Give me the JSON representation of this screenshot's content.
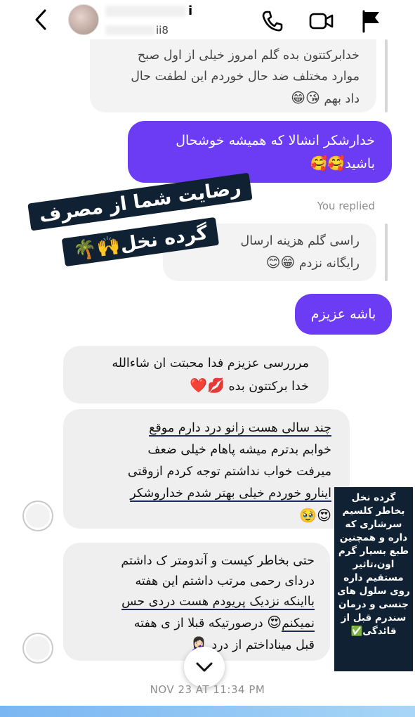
{
  "header": {
    "username": "i",
    "username_prefix": "mi...",
    "handle": "ii8",
    "icons": [
      "back-icon",
      "phone-icon",
      "video-icon",
      "flag-icon"
    ]
  },
  "messages": {
    "quoted_top": {
      "lines": [
        "خدابرکتتون بده گلم امروز خیلی از اول صبح",
        "موارد مختلف ضد حال خوردم این لطفت حال",
        "داد بهم"
      ],
      "emoji": "😘😁"
    },
    "outgoing_1": {
      "lines": [
        "خدارشکر انشالا که همیشه خوشحال",
        "باشید"
      ],
      "emoji": "🥰🥰"
    },
    "replied_label": "You replied",
    "quoted_mid": {
      "lines": [
        "راسی گلم هزینه ارسال",
        "رایگانه نزدم"
      ],
      "emoji": "😁😊"
    },
    "outgoing_2": {
      "text": "باشه عزیزم"
    },
    "incoming_1": {
      "lines": [
        "مرررسی عزیزم فدا محبتت ان شاءالله",
        "خدا برکتتون بده"
      ],
      "emoji": "💋❤️"
    },
    "incoming_2": {
      "lines": [
        "چند سالی هست زانو درد دارم موقع",
        "خوابم بدترم میشه پاهام خیلی ضعف",
        "میرفت خواب نداشتم توجه کردم ازوقتی",
        "اینارو خوردم خیلی بهتر شدم خداروشکر"
      ],
      "emoji": "😍🥹"
    },
    "incoming_3": {
      "lines": [
        "حتی بخاطر کیست و آندومتر ک داشتم",
        "دردای رحمی مرتب داشتم این هفته",
        "بااینکه نزدیک پریودم هست دردی حس",
        "نمیکنم",
        "درصورتیکه قبلا از ی هفته",
        "قبل میناداختم از درد"
      ],
      "emoji_a": "😍",
      "emoji_b": "🤦🏻‍♀️"
    }
  },
  "overlay": {
    "line1": "رضایت شما از مصرف",
    "line2": "گرده نخل",
    "line2_emoji": "🙌🌴"
  },
  "side_note": {
    "text": "گرده نخل بخاطر کلسیم سرشاری که داره و همچنین طبع بسیار گرم اون،تاثیر مستقیم داره روی سلول های جنسی و درمان سندرم قبل از قائدگی",
    "emoji": "✅"
  },
  "timestamp": "NOV 23 AT 11:34 PM",
  "colors": {
    "outgoing_bubble": "#6c3cf5",
    "incoming_bubble": "#efefef",
    "banner": "#0f2133"
  }
}
